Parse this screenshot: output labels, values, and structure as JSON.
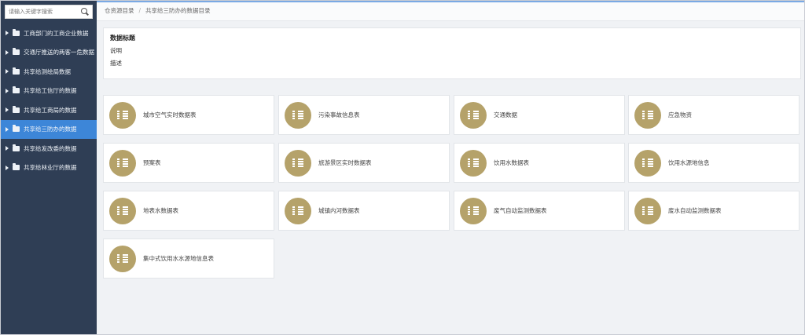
{
  "sidebar": {
    "search_placeholder": "请输入关键字搜索",
    "items": [
      {
        "label": "工商部门的工商企业数据"
      },
      {
        "label": "交通厅推送的两客一危数据"
      },
      {
        "label": "共享给测绘局数据"
      },
      {
        "label": "共享给工信厅的数据"
      },
      {
        "label": "共享给工商局的数据"
      },
      {
        "label": "共享给三防办的数据"
      },
      {
        "label": "共享给发改委的数据"
      },
      {
        "label": "共享给林业厅的数据"
      }
    ],
    "active_index": 5
  },
  "breadcrumb": {
    "root": "仓资源目录",
    "separator": "/",
    "current": "共享给三防办的数据目录"
  },
  "info": {
    "title": "数据标题",
    "line1": "说明",
    "line2": "描述"
  },
  "tiles": [
    {
      "label": "城市空气实时数据表"
    },
    {
      "label": "污染事故信息表"
    },
    {
      "label": "交通数据"
    },
    {
      "label": "应急物资"
    },
    {
      "label": "预案表"
    },
    {
      "label": "旅游景区实时数据表"
    },
    {
      "label": "饮用水数据表"
    },
    {
      "label": "饮用水源地信息"
    },
    {
      "label": "地表水数据表"
    },
    {
      "label": "城镇内河数据表"
    },
    {
      "label": "废气自动监测数据表"
    },
    {
      "label": "废水自动监测数据表"
    },
    {
      "label": "集中式饮用水水源地信息表"
    }
  ],
  "colors": {
    "sidebar_bg": "#2f3e55",
    "active_item": "#3d86d8",
    "tile_icon": "#b5a26a"
  }
}
